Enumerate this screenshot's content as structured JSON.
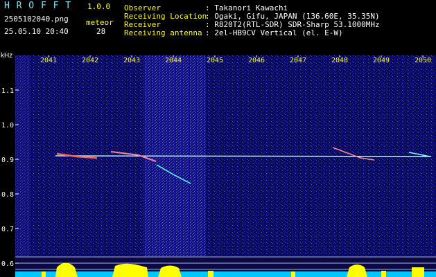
{
  "header": {
    "app_name": "H R O F F T",
    "version": "1.0.0",
    "file_name": "2505102040.png",
    "datetime": "25.05.10 20:40",
    "meteor_label": "meteor",
    "meteor_count": "28",
    "info": [
      {
        "label": "Observer",
        "value": ": Takanori Kawachi"
      },
      {
        "label": "Receiving Location",
        "value": ": Ogaki, Gifu, JAPAN (136.60E, 35.35N)"
      },
      {
        "label": "Receiver",
        "value": ": R820T2(RTL-SDR) SDR-Sharp 53.1000MHz"
      },
      {
        "label": "Receiving antenna",
        "value": ": 2el-HB9CV Vertical (el. E-W)"
      }
    ]
  },
  "chart_data": {
    "type": "heatmap",
    "ylabel": "kHz",
    "y_ticks": [
      "1.1",
      "1.0",
      "0.9",
      "0.8",
      "0.7",
      "0.6"
    ],
    "x_ticks": [
      "2041",
      "2042",
      "2043",
      "2044",
      "2045",
      "2046",
      "2047",
      "2048",
      "2049",
      "2050"
    ],
    "colors": {
      "background": "#0a0a5a",
      "noise": "#3a3aff",
      "carrier": "#aaffee",
      "tick_label": "#ffff00",
      "power_bar": "#ffff00",
      "baseline": "#00c8ff"
    }
  }
}
